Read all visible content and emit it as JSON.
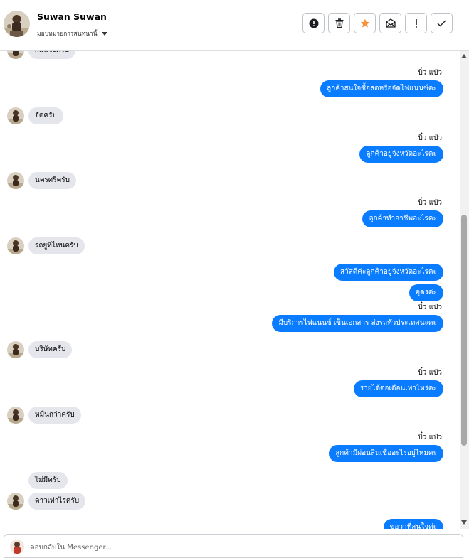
{
  "header": {
    "contact_name": "Suwan Suwan",
    "assign_label": "มอบหมายการสนทนานี้"
  },
  "actions": [
    {
      "name": "mark-spam-button",
      "icon": "exclamation-circle-icon"
    },
    {
      "name": "delete-button",
      "icon": "trash-icon"
    },
    {
      "name": "star-button",
      "icon": "star-icon",
      "color": "#f7923b"
    },
    {
      "name": "mark-unread-button",
      "icon": "envelope-icon"
    },
    {
      "name": "follow-up-button",
      "icon": "exclamation-icon"
    },
    {
      "name": "done-button",
      "icon": "check-icon"
    }
  ],
  "messages": [
    {
      "dir": "in",
      "text": "ผมแจ้งครับ"
    },
    {
      "dir": "out",
      "sender": "บิ๋ว แป๋ว",
      "text": "ลูกค้าสนใจซื้อสดหรือจัดไฟแนนซ์คะ"
    },
    {
      "dir": "in",
      "text": "จัดครับ"
    },
    {
      "dir": "out",
      "sender": "บิ๋ว แป๋ว",
      "text": "ลูกค้าอยู่จังหวัดอะไรคะ"
    },
    {
      "dir": "in",
      "text": "นครศรีครับ"
    },
    {
      "dir": "out",
      "sender": "บิ๋ว แป๋ว",
      "text": "ลูกค้าทำอาชีพอะไรคะ"
    },
    {
      "dir": "in",
      "text": "รถยูทีไหนครับ"
    },
    {
      "dir": "out",
      "text": "สวัสดีค่ะลูกค้าอยู่จังหวัดอะไรคะ"
    },
    {
      "dir": "out",
      "text": "อุดรค่ะ"
    },
    {
      "dir": "out",
      "sender": "บิ๋ว แป๋ว",
      "text": "มีบริการไฟแนนซ์ เซ็นเอกสาร ส่งรถทั่วประเทศนะคะ"
    },
    {
      "dir": "in",
      "text": "บริษัทครับ"
    },
    {
      "dir": "out",
      "sender": "บิ๋ว แป๋ว",
      "text": "รายได้ต่อเดือนเท่าไหร่คะ"
    },
    {
      "dir": "in",
      "text": "หมื่นกว่าครับ"
    },
    {
      "dir": "out",
      "sender": "บิ๋ว แป๋ว",
      "text": "ลูกค้ามีผ่อนสินเชื่ออะไรอยู่ไหมคะ"
    },
    {
      "dir": "in",
      "text": "ไม่มีครับ"
    },
    {
      "dir": "in",
      "text": "ดาวเท่าไรครับ"
    },
    {
      "dir": "out",
      "text": "ขอวาที่สนใจค่ะ"
    }
  ],
  "composer": {
    "placeholder": "ตอบกลับใน Messenger..."
  },
  "colors": {
    "outgoing_bubble": "#0a7cff",
    "incoming_bubble": "#e4e6eb"
  }
}
